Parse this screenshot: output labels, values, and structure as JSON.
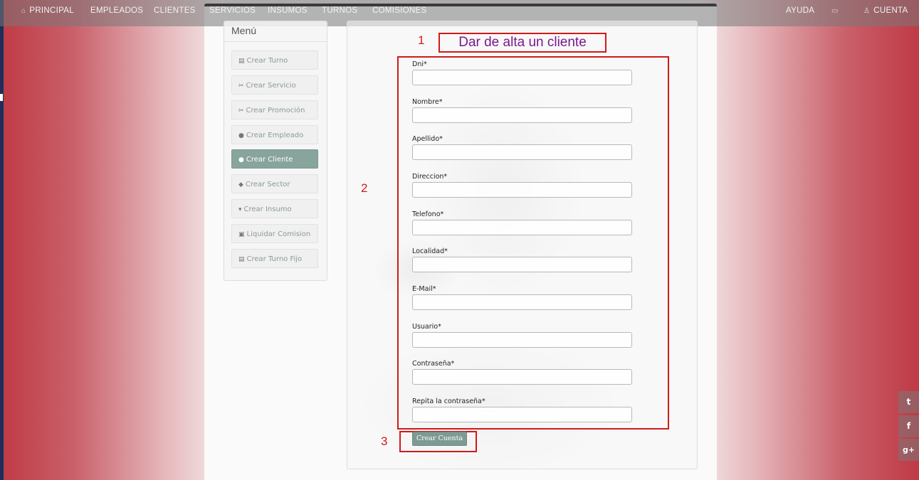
{
  "nav": {
    "principal": "PRINCIPAL",
    "empleados": "EMPLEADOS",
    "clientes": "CLIENTES",
    "servicios": "SERVICIOS",
    "insumos": "INSUMOS",
    "turnos": "TURNOS",
    "comisiones": "COMISIONES",
    "ayuda": "AYUDA",
    "cuenta": "CUENTA",
    "icons": {
      "home": "home-icon",
      "calendar": "calendar-icon",
      "user": "user-icon"
    }
  },
  "menu": {
    "title": "Menú",
    "items": [
      {
        "label": "Crear Turno",
        "icon": "calendar-icon"
      },
      {
        "label": "Crear Servicio",
        "icon": "scissors-icon"
      },
      {
        "label": "Crear Promoción",
        "icon": "scissors-icon"
      },
      {
        "label": "Crear Empleado",
        "icon": "user-icon"
      },
      {
        "label": "Crear Cliente",
        "icon": "user-icon",
        "active": true
      },
      {
        "label": "Crear Sector",
        "icon": "tags-icon"
      },
      {
        "label": "Crear Insumo",
        "icon": "cart-icon"
      },
      {
        "label": "Liquidar Comision",
        "icon": "money-icon"
      },
      {
        "label": "Crear Turno Fijo",
        "icon": "calendar-icon"
      }
    ]
  },
  "form": {
    "title": "Dar de alta un cliente",
    "fields": [
      {
        "label": "Dni*",
        "value": ""
      },
      {
        "label": "Nombre*",
        "value": ""
      },
      {
        "label": "Apellido*",
        "value": ""
      },
      {
        "label": "Direccion*",
        "value": ""
      },
      {
        "label": "Telefono*",
        "value": ""
      },
      {
        "label": "Localidad*",
        "value": ""
      },
      {
        "label": "E-Mail*",
        "value": ""
      },
      {
        "label": "Usuario*",
        "value": ""
      },
      {
        "label": "Contraseña*",
        "value": ""
      },
      {
        "label": "Repita la contraseña*",
        "value": ""
      }
    ],
    "submit_label": "Crear Cuenta"
  },
  "annotations": {
    "one": "1",
    "two": "2",
    "three": "3",
    "color": "#d11a1a"
  },
  "social": {
    "twitter": "twitter-icon",
    "facebook": "facebook-icon",
    "gplus": "google-plus-icon"
  }
}
